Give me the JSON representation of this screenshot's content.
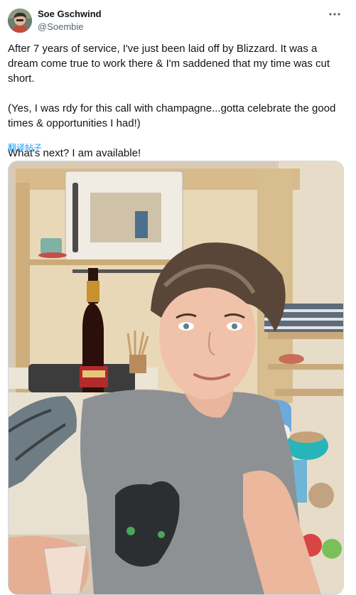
{
  "author": {
    "display_name": "Soe Gschwind",
    "handle": "@Soembie",
    "avatar_icon": "avatar-photo"
  },
  "menu": {
    "more_icon": "more-horizontal-icon"
  },
  "tweet": {
    "paragraphs": [
      "After 7 years of service, I've just been laid off by Blizzard. It was a dream come true to work there & I'm saddened that my time was cut short.",
      "(Yes, I was rdy for this call with champagne...gotta celebrate the good times & opportunities I had!)",
      "What's next? I am available!"
    ],
    "translate_label": "翻译帖子"
  },
  "media": {
    "type": "photo",
    "icon": "photo-selfie"
  },
  "colors": {
    "link": "#1d9bf0",
    "secondary_text": "#536471",
    "primary_text": "#0f1419",
    "border": "#cfd9de"
  }
}
